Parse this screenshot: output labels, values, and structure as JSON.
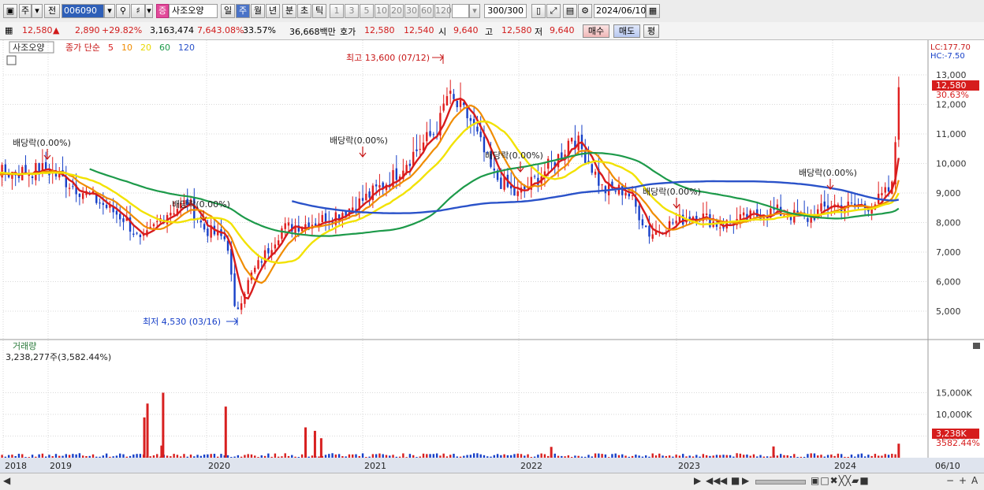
{
  "toolbar": {
    "period_type": "주",
    "view_mode": "전",
    "stock_code": "006090",
    "stock_name": "사조오양",
    "stock_badge": "증",
    "periods": [
      "일",
      "주",
      "월",
      "년",
      "분",
      "초",
      "틱"
    ],
    "active_period": "주",
    "intervals": [
      "1",
      "3",
      "5",
      "10",
      "20",
      "30",
      "60",
      "120"
    ],
    "count": "300",
    "count_total": "/300",
    "date": "2024/06/10"
  },
  "quote": {
    "price": "12,580",
    "change": "2,890",
    "change_pct": "+29.82%",
    "volume": "3,163,474",
    "volume_pct": "7,643.08%",
    "turnover": "33.57%",
    "amount": "36,668백만",
    "bid_label": "호가",
    "ask": "12,580",
    "bid": "12,540",
    "open_label": "시",
    "open": "9,640",
    "high_label": "고",
    "high": "12,580",
    "low_label": "저",
    "low": "9,640",
    "buy_button": "매수",
    "sell_button": "매도",
    "eval_button": "평"
  },
  "chart_data": {
    "type": "candlestick",
    "title": "사조오양",
    "legend": {
      "prefix": "종가 단순",
      "ma_periods": [
        {
          "label": "5",
          "color": "#d81c1c"
        },
        {
          "label": "10",
          "color": "#f08c00"
        },
        {
          "label": "20",
          "color": "#e8d800"
        },
        {
          "label": "60",
          "color": "#1d9a4a"
        },
        {
          "label": "120",
          "color": "#2a52c9"
        }
      ]
    },
    "price_axis": {
      "ticks": [
        13000,
        12000,
        11000,
        10000,
        9000,
        8000,
        7000,
        6000,
        5000
      ],
      "tick_labels": [
        "13,000",
        "12,000",
        "11,000",
        "10,000",
        "9,000",
        "8,000",
        "7,000",
        "6,000",
        "5,000"
      ],
      "range": [
        4000,
        14000
      ]
    },
    "lc_label": "LC:177.70",
    "hc_label": "HC:-7.50",
    "current_price_tag": "12,580",
    "current_pct_tag": "30.63%",
    "x_labels": [
      "2018",
      "2019",
      "2020",
      "2021",
      "2022",
      "2023",
      "2024",
      "06/10"
    ],
    "high_annotation": "최고 13,600 (07/12)",
    "low_annotation": "최저 4,530 (03/16)",
    "dividend_marks": [
      "배당락(0.00%)",
      "배당락(0.00%)",
      "배당락(0.00%)",
      "배당락(0.00%)",
      "배당락(0.00%)",
      "배당락(0.00%)"
    ],
    "volume": {
      "title": "거래량",
      "value_label": "3,238,277주(3,582.44%)",
      "axis_labels": [
        "15,000K",
        "10,000K",
        "5,000K"
      ],
      "current_tag": "3,238K",
      "current_pct_tag": "3582.44%"
    },
    "series_approx": {
      "ma5": [
        [
          2018.0,
          11600
        ],
        [
          2018.2,
          10100
        ],
        [
          2018.5,
          9600
        ],
        [
          2018.8,
          9700
        ],
        [
          2019.0,
          9800
        ],
        [
          2019.3,
          8800
        ],
        [
          2019.5,
          8100
        ],
        [
          2019.6,
          7300
        ],
        [
          2019.75,
          8300
        ],
        [
          2019.9,
          8700
        ],
        [
          2020.0,
          7800
        ],
        [
          2020.15,
          7400
        ],
        [
          2020.2,
          4900
        ],
        [
          2020.3,
          6200
        ],
        [
          2020.5,
          7800
        ],
        [
          2020.7,
          8000
        ],
        [
          2020.9,
          8400
        ],
        [
          2021.0,
          8700
        ],
        [
          2021.2,
          9500
        ],
        [
          2021.35,
          10400
        ],
        [
          2021.5,
          11200
        ],
        [
          2021.55,
          12300
        ],
        [
          2021.7,
          11500
        ],
        [
          2021.85,
          9600
        ],
        [
          2022.0,
          8900
        ],
        [
          2022.15,
          9600
        ],
        [
          2022.3,
          10400
        ],
        [
          2022.35,
          11000
        ],
        [
          2022.45,
          10200
        ],
        [
          2022.55,
          9100
        ],
        [
          2022.7,
          9100
        ],
        [
          2022.85,
          7600
        ],
        [
          2023.0,
          8000
        ],
        [
          2023.15,
          8300
        ],
        [
          2023.3,
          7900
        ],
        [
          2023.5,
          8200
        ],
        [
          2023.65,
          8400
        ],
        [
          2023.85,
          8100
        ],
        [
          2024.0,
          8600
        ],
        [
          2024.2,
          8500
        ],
        [
          2024.3,
          8700
        ],
        [
          2024.4,
          9200
        ],
        [
          2024.44,
          12580
        ]
      ]
    }
  },
  "statusbar": {
    "nav_buttons": [
      "◀◀",
      "◀",
      "■",
      "▶"
    ],
    "tools": [
      "−",
      "+",
      "A"
    ]
  }
}
